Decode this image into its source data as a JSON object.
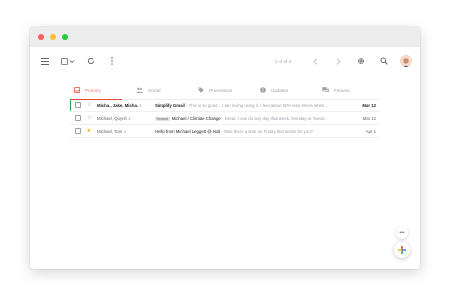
{
  "window": {
    "controls": {
      "close_color": "#ff5f57",
      "minimize_color": "#febc2e",
      "maximize_color": "#28c840"
    }
  },
  "toolbar": {
    "left_icons": [
      "menu-icon",
      "select-all-checkbox",
      "chevron-down-icon",
      "refresh-icon",
      "more-vertical-icon"
    ],
    "count_text": "1–4 of 4",
    "right_icons": [
      "chevron-left-icon",
      "chevron-right-icon",
      "gear-icon",
      "search-icon",
      "avatar"
    ]
  },
  "tabs": [
    {
      "label": "Primary",
      "icon": "inbox-icon",
      "active": true
    },
    {
      "label": "Social",
      "icon": "people-icon",
      "active": false
    },
    {
      "label": "Promotions",
      "icon": "tag-icon",
      "active": false
    },
    {
      "label": "Updates",
      "icon": "info-icon",
      "active": false
    },
    {
      "label": "Forums",
      "icon": "forum-icon",
      "active": false
    }
  ],
  "emails": [
    {
      "sender": "Micha., Jake, Micha.",
      "count": "4",
      "label": "",
      "subject": "Simplify Gmail",
      "snippet": " - This is so good... I am loving using it. I feel about 50% less stress when...",
      "date": "Mar 12",
      "unread": true,
      "starred": false
    },
    {
      "sender": "Michael, Quynh",
      "count": "4",
      "label": "School",
      "subject": "Michael / Climate Change",
      "snippet": " - Great. I can do any day that week. Monday or Tuesd..",
      "date": "Mar 12",
      "unread": false,
      "starred": false
    },
    {
      "sender": "Michael, Tom",
      "count": "4",
      "label": "",
      "subject": "Hello from Michael Leggett @ Noil",
      "snippet": " - Was there a time on Friday that works for you?",
      "date": "Apr 1",
      "unread": false,
      "starred": true
    }
  ],
  "fab": {
    "more_label": "•••",
    "compose_icon": "plus-icon"
  }
}
